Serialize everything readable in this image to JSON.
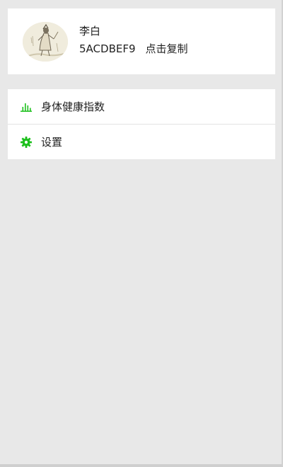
{
  "profile": {
    "name": "李白",
    "user_id": "5ACDBEF9",
    "copy_label": "点击复制"
  },
  "menu": {
    "items": [
      {
        "label": "身体健康指数",
        "icon": "bar-chart-icon"
      },
      {
        "label": "设置",
        "icon": "gear-icon"
      }
    ]
  },
  "colors": {
    "accent": "#1ec01e",
    "background": "#e8e8e8"
  }
}
